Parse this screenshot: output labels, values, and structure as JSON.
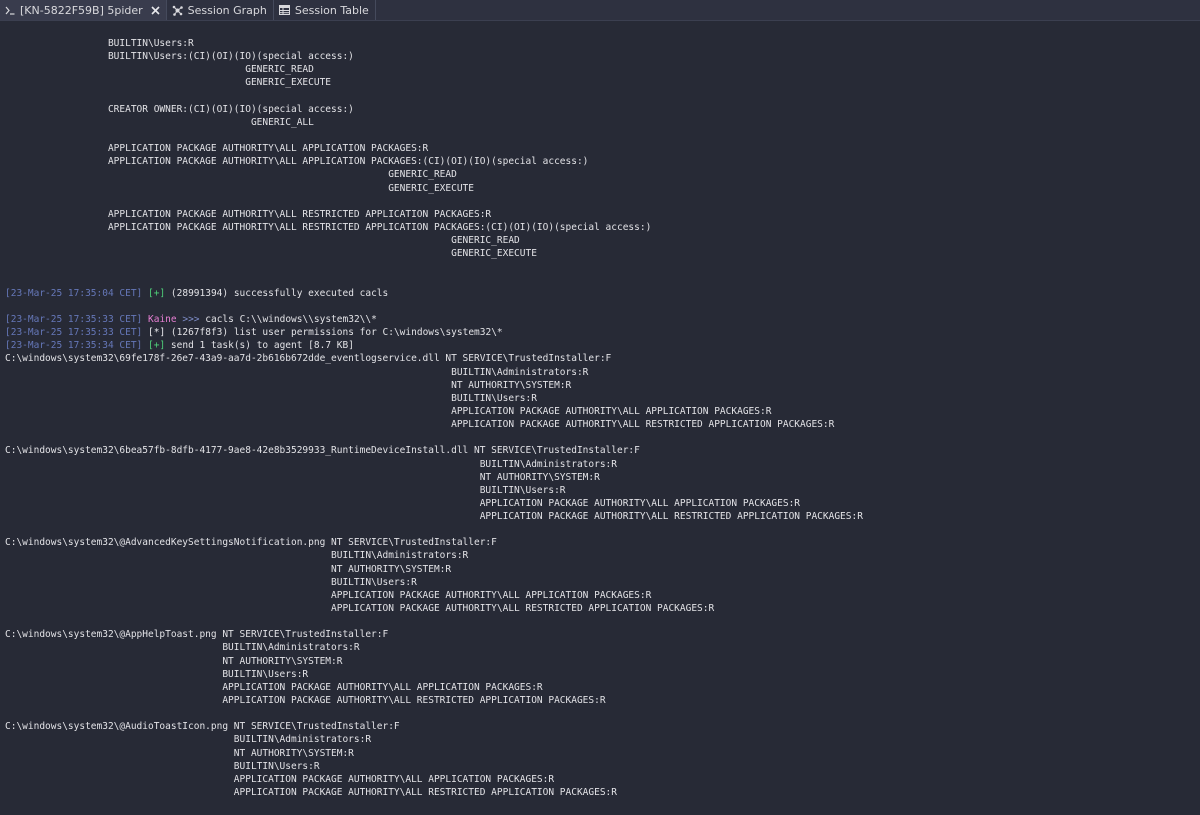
{
  "tabs": [
    {
      "label": "[KN-5822F59B] 5pider",
      "icon": "terminal-icon",
      "closable": true,
      "active": true
    },
    {
      "label": "Session Graph",
      "icon": "graph-icon",
      "closable": false,
      "active": false
    },
    {
      "label": "Session Table",
      "icon": "table-icon",
      "closable": false,
      "active": false
    }
  ],
  "colors": {
    "background": "#272a36",
    "timestamp": "#6577b8",
    "success": "#4fd07a",
    "operator": "#e67fd2",
    "text": "#e2e2e6"
  },
  "console": {
    "block1": [
      "                  BUILTIN\\Users:R",
      "                  BUILTIN\\Users:(CI)(OI)(IO)(special access:)",
      "                                          GENERIC_READ",
      "                                          GENERIC_EXECUTE",
      "",
      "                  CREATOR OWNER:(CI)(OI)(IO)(special access:)",
      "                                           GENERIC_ALL",
      "",
      "                  APPLICATION PACKAGE AUTHORITY\\ALL APPLICATION PACKAGES:R",
      "                  APPLICATION PACKAGE AUTHORITY\\ALL APPLICATION PACKAGES:(CI)(OI)(IO)(special access:)",
      "                                                                   GENERIC_READ",
      "                                                                   GENERIC_EXECUTE",
      "",
      "                  APPLICATION PACKAGE AUTHORITY\\ALL RESTRICTED APPLICATION PACKAGES:R",
      "                  APPLICATION PACKAGE AUTHORITY\\ALL RESTRICTED APPLICATION PACKAGES:(CI)(OI)(IO)(special access:)",
      "                                                                              GENERIC_READ",
      "                                                                              GENERIC_EXECUTE",
      "",
      ""
    ],
    "exec_result": {
      "timestamp": "[23-Mar-25 17:35:04 CET]",
      "marker": "[+]",
      "text": " (28991394) successfully executed cacls"
    },
    "command": {
      "timestamp": "[23-Mar-25 17:35:33 CET]",
      "operator": "Kaine",
      "prompt": ">>>",
      "text": " cacls C:\\\\windows\\\\system32\\\\*"
    },
    "task_info": {
      "timestamp": "[23-Mar-25 17:35:33 CET]",
      "marker": "[*]",
      "text": " (1267f8f3) list user permissions for C:\\windows\\system32\\*"
    },
    "task_sent": {
      "timestamp": "[23-Mar-25 17:35:34 CET]",
      "marker": "[+]",
      "text": " send 1 task(s) to agent [8.7 KB]"
    },
    "block2": [
      "C:\\windows\\system32\\69fe178f-26e7-43a9-aa7d-2b616b672dde_eventlogservice.dll NT SERVICE\\TrustedInstaller:F",
      "                                                                              BUILTIN\\Administrators:R",
      "                                                                              NT AUTHORITY\\SYSTEM:R",
      "                                                                              BUILTIN\\Users:R",
      "                                                                              APPLICATION PACKAGE AUTHORITY\\ALL APPLICATION PACKAGES:R",
      "                                                                              APPLICATION PACKAGE AUTHORITY\\ALL RESTRICTED APPLICATION PACKAGES:R",
      "",
      "C:\\windows\\system32\\6bea57fb-8dfb-4177-9ae8-42e8b3529933_RuntimeDeviceInstall.dll NT SERVICE\\TrustedInstaller:F",
      "                                                                                   BUILTIN\\Administrators:R",
      "                                                                                   NT AUTHORITY\\SYSTEM:R",
      "                                                                                   BUILTIN\\Users:R",
      "                                                                                   APPLICATION PACKAGE AUTHORITY\\ALL APPLICATION PACKAGES:R",
      "                                                                                   APPLICATION PACKAGE AUTHORITY\\ALL RESTRICTED APPLICATION PACKAGES:R",
      "",
      "C:\\windows\\system32\\@AdvancedKeySettingsNotification.png NT SERVICE\\TrustedInstaller:F",
      "                                                         BUILTIN\\Administrators:R",
      "                                                         NT AUTHORITY\\SYSTEM:R",
      "                                                         BUILTIN\\Users:R",
      "                                                         APPLICATION PACKAGE AUTHORITY\\ALL APPLICATION PACKAGES:R",
      "                                                         APPLICATION PACKAGE AUTHORITY\\ALL RESTRICTED APPLICATION PACKAGES:R",
      "",
      "C:\\windows\\system32\\@AppHelpToast.png NT SERVICE\\TrustedInstaller:F",
      "                                      BUILTIN\\Administrators:R",
      "                                      NT AUTHORITY\\SYSTEM:R",
      "                                      BUILTIN\\Users:R",
      "                                      APPLICATION PACKAGE AUTHORITY\\ALL APPLICATION PACKAGES:R",
      "                                      APPLICATION PACKAGE AUTHORITY\\ALL RESTRICTED APPLICATION PACKAGES:R",
      "",
      "C:\\windows\\system32\\@AudioToastIcon.png NT SERVICE\\TrustedInstaller:F",
      "                                        BUILTIN\\Administrators:R",
      "                                        NT AUTHORITY\\SYSTEM:R",
      "                                        BUILTIN\\Users:R",
      "                                        APPLICATION PACKAGE AUTHORITY\\ALL APPLICATION PACKAGES:R",
      "                                        APPLICATION PACKAGE AUTHORITY\\ALL RESTRICTED APPLICATION PACKAGES:R"
    ]
  }
}
